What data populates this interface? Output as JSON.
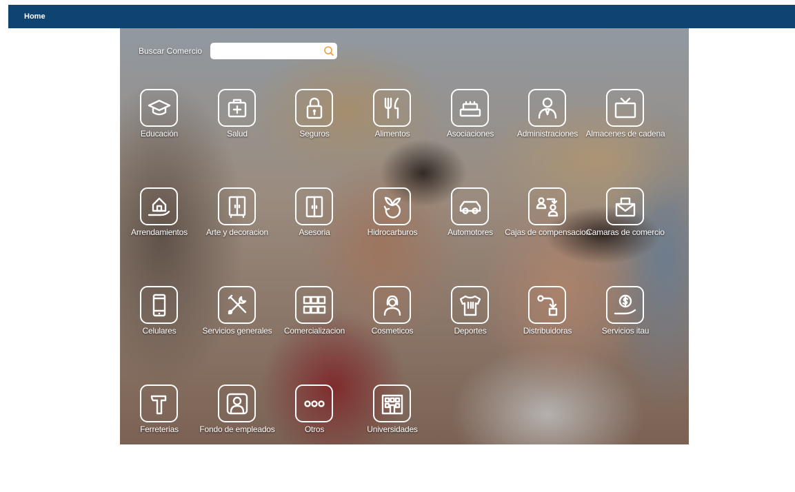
{
  "nav": {
    "home_label": "Home"
  },
  "search": {
    "label": "Buscar Comercio",
    "value": "",
    "placeholder": ""
  },
  "categories": [
    {
      "label": "Educación",
      "icon": "graduation-cap-icon"
    },
    {
      "label": "Salud",
      "icon": "medical-kit-icon"
    },
    {
      "label": "Seguros",
      "icon": "padlock-icon"
    },
    {
      "label": "Alimentos",
      "icon": "fork-knife-icon"
    },
    {
      "label": "Asociaciones",
      "icon": "blocks-icon"
    },
    {
      "label": "Administraciones",
      "icon": "person-tie-icon"
    },
    {
      "label": "Almacenes de cadena",
      "icon": "tv-icon"
    },
    {
      "label": "Arrendamientos",
      "icon": "house-hand-icon"
    },
    {
      "label": "Arte y decoracion",
      "icon": "wardrobe-icon"
    },
    {
      "label": "Asesoria",
      "icon": "door-icon"
    },
    {
      "label": "Hidrocarburos",
      "icon": "leaf-recycle-icon"
    },
    {
      "label": "Automotores",
      "icon": "car-icon"
    },
    {
      "label": "Cajas de compensacion",
      "icon": "people-exchange-icon"
    },
    {
      "label": "Camaras de comercio",
      "icon": "envelope-icon"
    },
    {
      "label": "Celulares",
      "icon": "phone-icon"
    },
    {
      "label": "Servicios generales",
      "icon": "tools-icon"
    },
    {
      "label": "Comercializacion",
      "icon": "grid-boxes-icon"
    },
    {
      "label": "Cosmeticos",
      "icon": "woman-icon"
    },
    {
      "label": "Deportes",
      "icon": "jersey-icon"
    },
    {
      "label": "Distribuidoras",
      "icon": "route-icon"
    },
    {
      "label": "Servicios itau",
      "icon": "coin-hand-icon"
    },
    {
      "label": "Ferreterias",
      "icon": "hammer-icon"
    },
    {
      "label": "Fondo de empleados",
      "icon": "employee-icon"
    },
    {
      "label": "Otros",
      "icon": "dots-icon"
    },
    {
      "label": "Universidades",
      "icon": "building-icon"
    }
  ],
  "colors": {
    "nav_bar": "#0f4470",
    "search_icon": "#f39c3a",
    "tile_stroke": "#ffffff"
  }
}
